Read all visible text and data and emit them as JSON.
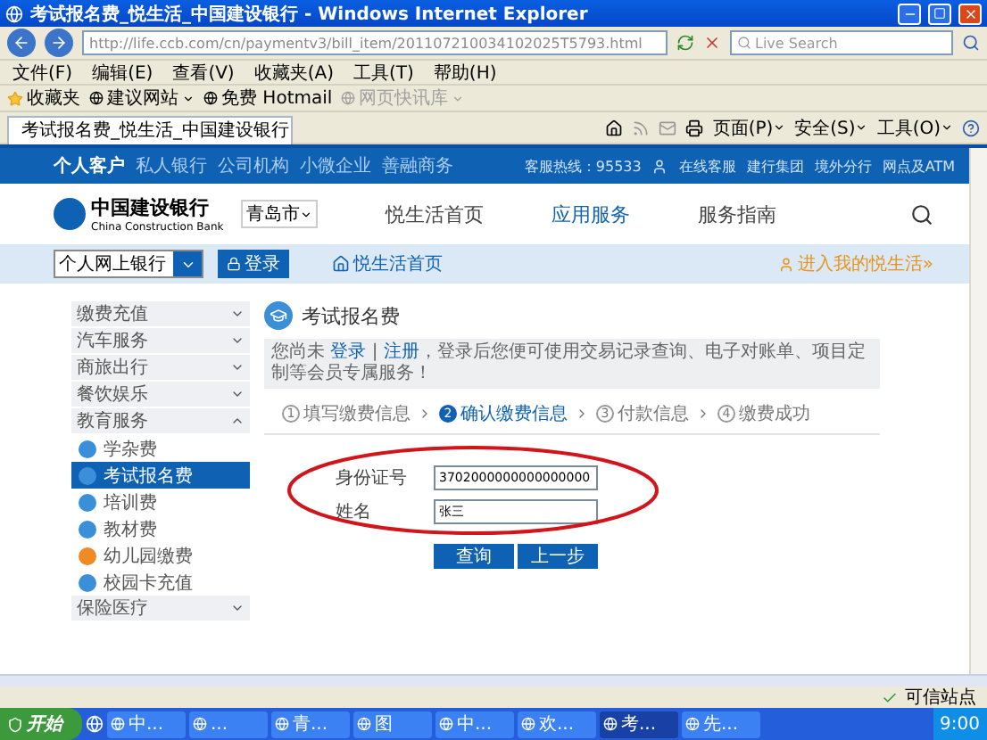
{
  "window": {
    "title": "考试报名费_悦生活_中国建设银行 - Windows Internet Explorer"
  },
  "address_bar": {
    "url": "http://life.ccb.com/cn/paymentv3/bill_item/201107210034102025T5793.html",
    "search_placeholder": "Live Search"
  },
  "menu": [
    "文件(F)",
    "编辑(E)",
    "查看(V)",
    "收藏夹(A)",
    "工具(T)",
    "帮助(H)"
  ],
  "favorites_bar": {
    "label": "收藏夹",
    "items": [
      {
        "label": "建议网站",
        "dropdown": true,
        "disabled": false
      },
      {
        "label": "免费 Hotmail",
        "dropdown": false,
        "disabled": false
      },
      {
        "label": "网页快讯库",
        "dropdown": true,
        "disabled": true
      }
    ]
  },
  "tab": {
    "title": "考试报名费_悦生活_中国建设银行"
  },
  "command_bar": [
    "页面(P)",
    "安全(S)",
    "工具(O)"
  ],
  "site": {
    "top_nav": [
      {
        "label": "个人客户",
        "selected": true
      },
      {
        "label": "私人银行",
        "selected": false
      },
      {
        "label": "公司机构",
        "selected": false
      },
      {
        "label": "小微企业",
        "selected": false
      },
      {
        "label": "善融商务",
        "selected": false
      }
    ],
    "hotline": "客服热线：95533",
    "online_service": "在线客服",
    "right_links": [
      "建行集团",
      "境外分行",
      "网点及ATM"
    ],
    "logo": {
      "name": "中国建设银行",
      "name_en": "China Construction Bank"
    },
    "city": "青岛市",
    "main_nav": [
      {
        "label": "悦生活首页",
        "selected": false
      },
      {
        "label": "应用服务",
        "selected": true
      },
      {
        "label": "服务指南",
        "selected": false
      }
    ],
    "login": {
      "channel": "个人网上银行",
      "button": "登录"
    },
    "breadcrumb": "悦生活首页",
    "my_life_link": "进入我的悦生活»"
  },
  "sidebar": [
    {
      "label": "缴费充值",
      "expanded": false
    },
    {
      "label": "汽车服务",
      "expanded": false
    },
    {
      "label": "商旅出行",
      "expanded": false
    },
    {
      "label": "餐饮娱乐",
      "expanded": false
    },
    {
      "label": "教育服务",
      "expanded": true,
      "children": [
        {
          "label": "学杂费",
          "selected": false,
          "color": "#3a8fd8"
        },
        {
          "label": "考试报名费",
          "selected": true,
          "color": "#3a8fd8"
        },
        {
          "label": "培训费",
          "selected": false,
          "color": "#3a8fd8"
        },
        {
          "label": "教材费",
          "selected": false,
          "color": "#3a8fd8"
        },
        {
          "label": "幼儿园缴费",
          "selected": false,
          "color": "#f08a24"
        },
        {
          "label": "校园卡充值",
          "selected": false,
          "color": "#3a8fd8"
        }
      ]
    },
    {
      "label": "保险医疗",
      "expanded": false
    }
  ],
  "form": {
    "title": "考试报名费",
    "notice_prefix": "您尚未",
    "login_link": "登录",
    "separator": "|",
    "register_link": "注册",
    "notice_rest": "，登录后您便可使用交易记录查询、电子对账单、项目定制等会员专属服务！",
    "steps": [
      {
        "number": "1",
        "label": "填写缴费信息",
        "selected": false
      },
      {
        "number": "2",
        "label": "确认缴费信息",
        "selected": true
      },
      {
        "number": "3",
        "label": "付款信息",
        "selected": false
      },
      {
        "number": "4",
        "label": "缴费成功",
        "selected": false
      }
    ],
    "fields": [
      {
        "label": "身份证号",
        "value": "3702000000000000000"
      },
      {
        "label": "姓名",
        "value": "张三"
      }
    ],
    "buttons": [
      "查询",
      "上一步"
    ]
  },
  "status_bar": {
    "zone": "可信站点"
  },
  "taskbar": {
    "start": "开始",
    "tasks": [
      {
        "label": "中...",
        "selected": false
      },
      {
        "label": "...",
        "selected": false
      },
      {
        "label": "青...",
        "selected": false
      },
      {
        "label": "图",
        "selected": false
      },
      {
        "label": "中...",
        "selected": false
      },
      {
        "label": "欢...",
        "selected": false
      },
      {
        "label": "考...",
        "selected": true
      },
      {
        "label": "先...",
        "selected": false
      }
    ],
    "clock": "9:00"
  }
}
